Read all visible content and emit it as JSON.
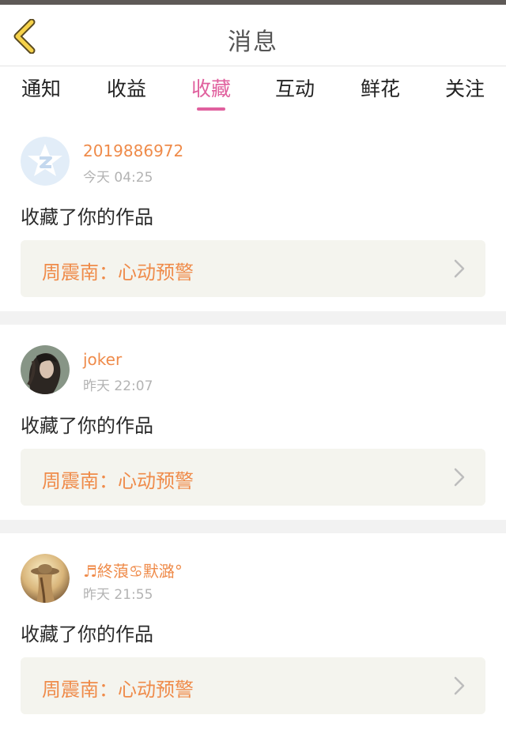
{
  "header": {
    "title": "消息",
    "back_icon": "chevron-left-icon"
  },
  "tabs": [
    {
      "label": "通知",
      "active": false
    },
    {
      "label": "收益",
      "active": false
    },
    {
      "label": "收藏",
      "active": true
    },
    {
      "label": "互动",
      "active": false
    },
    {
      "label": "鲜花",
      "active": false
    },
    {
      "label": "关注",
      "active": false
    }
  ],
  "colors": {
    "accent": "#e0609e",
    "name": "#ef8b4a",
    "time": "#b3b3b3",
    "card_bg": "#f4f4ee"
  },
  "items": [
    {
      "name": "2019886972",
      "time": "今天 04:25",
      "action": "收藏了你的作品",
      "work": "周震南：心动预警",
      "avatar": "qq-default-avatar"
    },
    {
      "name": "joker",
      "time": "昨天 22:07",
      "action": "收藏了你的作品",
      "work": "周震南：心动预警",
      "avatar": "user-photo-avatar"
    },
    {
      "name": "♬終蒗♋默潞°",
      "time": "昨天 21:55",
      "action": "收藏了你的作品",
      "work": "周震南：心动预警",
      "avatar": "user-photo-avatar"
    }
  ]
}
